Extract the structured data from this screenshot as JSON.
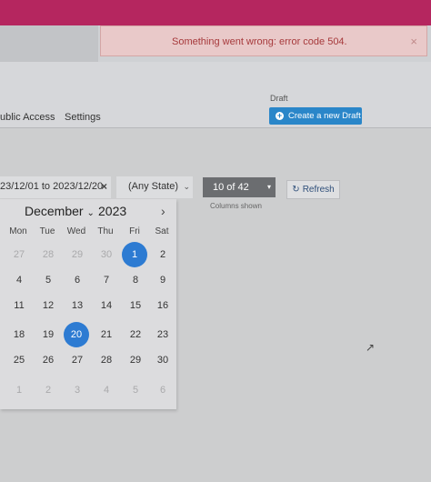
{
  "alert": {
    "message": "Something went wrong: error code 504.",
    "close": "×"
  },
  "nav": {
    "tabs": [
      "ublic Access",
      "Settings"
    ]
  },
  "draft": {
    "label": "Draft",
    "button": "Create a new Draft",
    "icon": "plus-circle-icon"
  },
  "filters": {
    "date_range": "23/12/01 to 2023/12/20",
    "clear": "×",
    "state": "(Any State)",
    "state_caret": "⌄",
    "columns": "10 of 42",
    "columns_caret": "▾",
    "columns_caption": "Columns shown"
  },
  "refresh": {
    "label": "Refresh",
    "icon": "refresh-icon"
  },
  "calendar": {
    "month": "December",
    "month_caret": "⌄",
    "year": "2023",
    "next": "›",
    "weekdays": [
      "Mon",
      "Tue",
      "Wed",
      "Thu",
      "Fri",
      "Sat"
    ],
    "weeks": [
      [
        "27",
        "28",
        "29",
        "30",
        "1",
        "2"
      ],
      [
        "4",
        "5",
        "6",
        "7",
        "8",
        "9"
      ],
      [
        "11",
        "12",
        "13",
        "14",
        "15",
        "16"
      ],
      [
        "18",
        "19",
        "20",
        "21",
        "22",
        "23"
      ],
      [
        "25",
        "26",
        "27",
        "28",
        "29",
        "30"
      ],
      [
        "1",
        "2",
        "3",
        "4",
        "5",
        "6"
      ]
    ],
    "muted_weeks": [
      0,
      5
    ],
    "muted_first_week_count": 4,
    "selected": [
      [
        0,
        4
      ],
      [
        3,
        2
      ]
    ],
    "accent": "#2d7bd2"
  }
}
